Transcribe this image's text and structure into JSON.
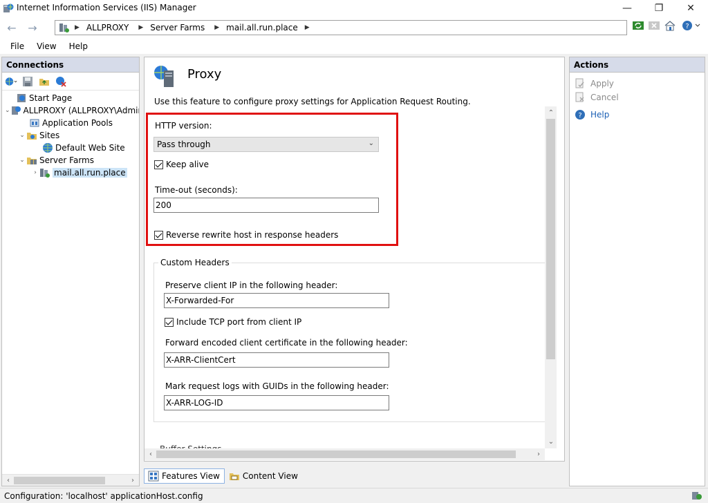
{
  "window": {
    "title": "Internet Information Services (IIS) Manager",
    "minimize": "—",
    "maximize": "❐",
    "close": "✕"
  },
  "address": {
    "back": "←",
    "forward": "→",
    "breadcrumbs": [
      "ALLPROXY",
      "Server Farms",
      "mail.all.run.place"
    ]
  },
  "menu": {
    "file": "File",
    "view": "View",
    "help": "Help"
  },
  "connections": {
    "title": "Connections",
    "tree": [
      {
        "label": "Start Page",
        "icon": "start-page-icon"
      },
      {
        "label": "ALLPROXY (ALLPROXY\\Administrator)",
        "icon": "server-icon"
      },
      {
        "label": "Application Pools",
        "icon": "app-pools-icon"
      },
      {
        "label": "Sites",
        "icon": "sites-folder-icon"
      },
      {
        "label": "Default Web Site",
        "icon": "globe-icon"
      },
      {
        "label": "Server Farms",
        "icon": "server-farms-icon"
      },
      {
        "label": "mail.all.run.place",
        "icon": "server-farm-icon"
      }
    ]
  },
  "feature": {
    "title": "Proxy",
    "description": "Use this feature to configure proxy settings for Application Request Routing.",
    "http_version_label": "HTTP version:",
    "http_version_value": "Pass through",
    "keep_alive_label": "Keep alive",
    "keep_alive": true,
    "timeout_label": "Time-out (seconds):",
    "timeout_value": "200",
    "reverse_rewrite_label": "Reverse rewrite host in response headers",
    "reverse_rewrite": true,
    "custom_headers": {
      "title": "Custom Headers",
      "preserve_ip_label": "Preserve client IP in the following header:",
      "preserve_ip_value": "X-Forwarded-For",
      "include_port_label": "Include TCP port from client IP",
      "include_port": true,
      "client_cert_label": "Forward encoded client certificate in the following header:",
      "client_cert_value": "X-ARR-ClientCert",
      "guid_label": "Mark request logs with GUIDs in the following header:",
      "guid_value": "X-ARR-LOG-ID"
    },
    "next_section_label": "Buffer Settings"
  },
  "view_tabs": {
    "features": "Features View",
    "content": "Content View"
  },
  "actions": {
    "title": "Actions",
    "apply": "Apply",
    "cancel": "Cancel",
    "help": "Help"
  },
  "status": {
    "text": "Configuration: 'localhost' applicationHost.config"
  },
  "colors": {
    "highlight_box": "#e01010",
    "pane_header": "#d6dbe9",
    "link": "#1a5fb4"
  }
}
